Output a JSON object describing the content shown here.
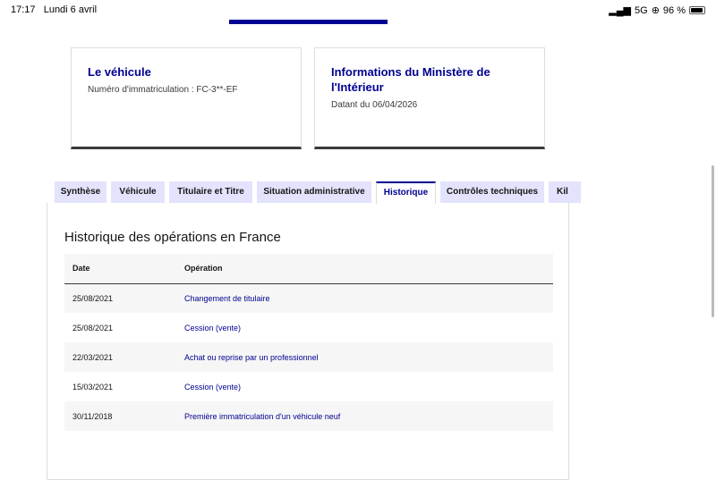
{
  "status": {
    "time": "17:17",
    "date": "Lundi 6 avril",
    "network": "5G",
    "battery": "96 %"
  },
  "cards": [
    {
      "title": "Le véhicule",
      "text": "Numéro d'immatriculation : FC-3**-EF"
    },
    {
      "title": "Informations du Ministère de l'Intérieur",
      "text": "Datant du 06/04/2026"
    }
  ],
  "tabs": [
    "Synthèse",
    "Véhicule",
    "Titulaire et Titre",
    "Situation administrative",
    "Historique",
    "Contrôles techniques",
    "Kil"
  ],
  "history": {
    "title": "Historique des opérations en France",
    "headers": [
      "Date",
      "Opération"
    ],
    "rows": [
      [
        "25/08/2021",
        "Changement de titulaire"
      ],
      [
        "25/08/2021",
        "Cession (vente)"
      ],
      [
        "22/03/2021",
        "Achat ou reprise par un professionnel"
      ],
      [
        "15/03/2021",
        "Cession (vente)"
      ],
      [
        "30/11/2018",
        "Première immatriculation d'un véhicule neuf"
      ]
    ]
  }
}
